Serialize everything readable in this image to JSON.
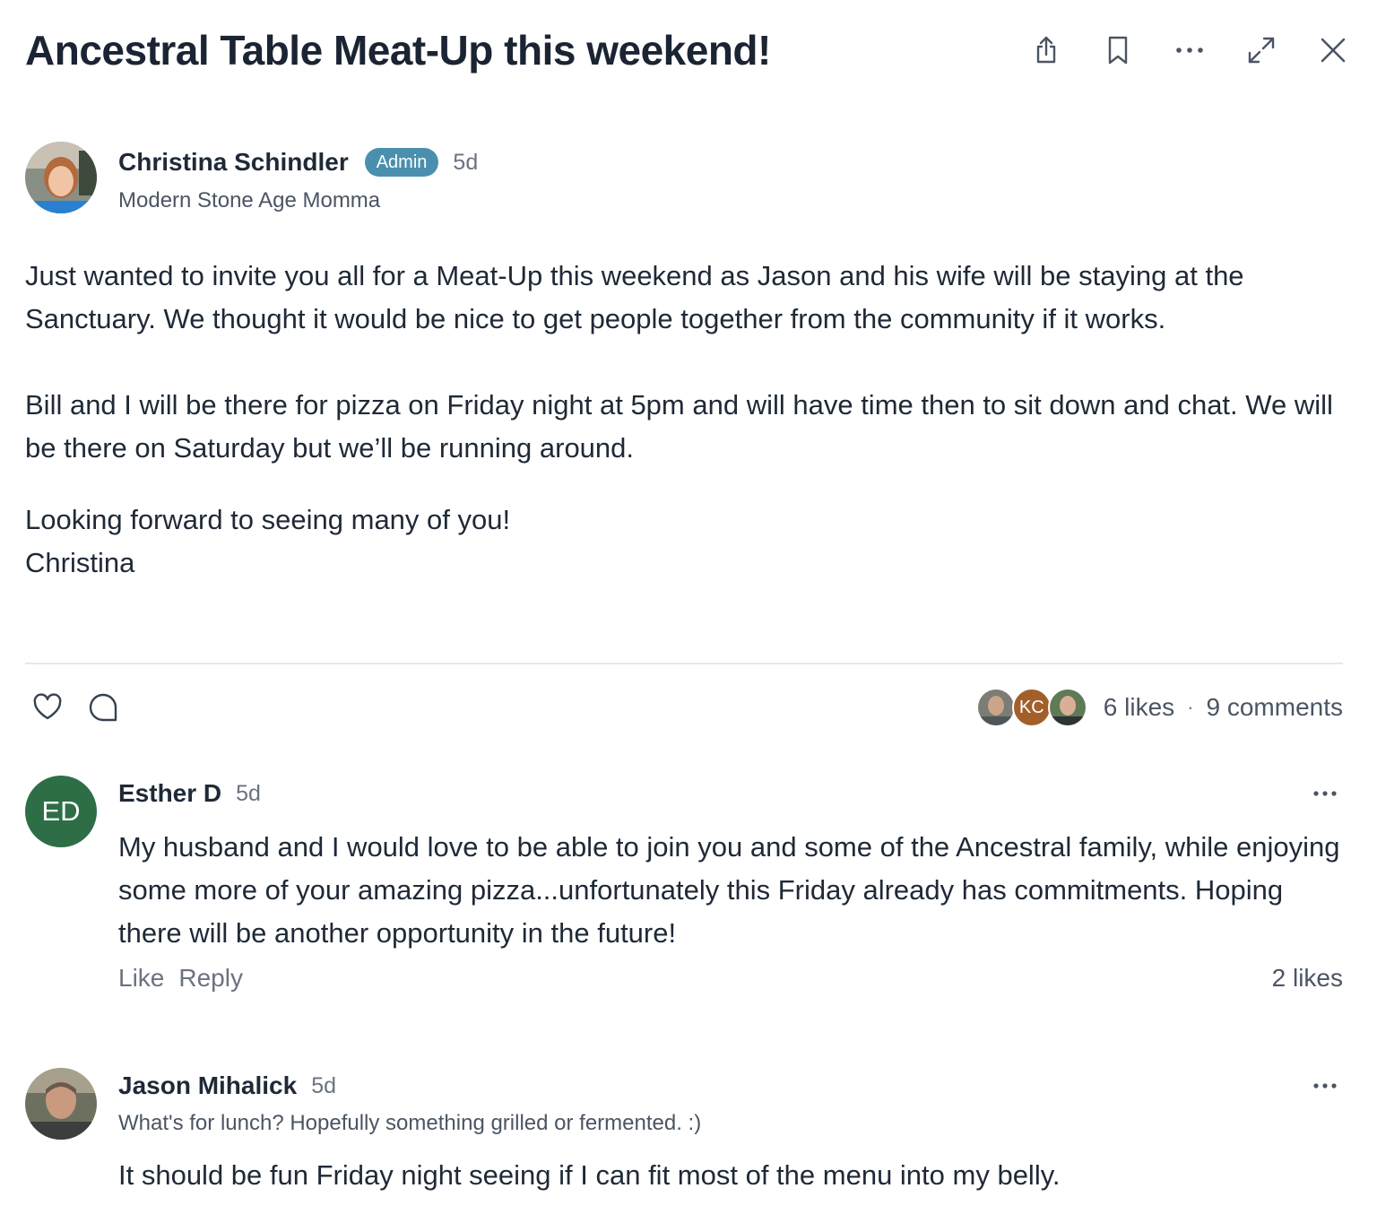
{
  "post": {
    "title": "Ancestral Table Meat-Up this weekend!",
    "author": {
      "name": "Christina Schindler",
      "badge": "Admin",
      "time": "5d",
      "subtitle": "Modern Stone Age Momma"
    },
    "paragraphs": [
      "Just wanted to invite you all for a Meat-Up this weekend as Jason and his wife will be staying at the Sanctuary. We thought it would be nice to get people together from the community if it works.",
      "Bill and I will be there for pizza on Friday night at 5pm and will have time then to sit down and chat. We will be there on Saturday but we’ll be running around.",
      "Looking forward to seeing many of you!",
      "Christina"
    ]
  },
  "header_icons": [
    "share-icon",
    "bookmark-icon",
    "more-icon",
    "expand-icon",
    "close-icon"
  ],
  "reactions": {
    "liker_initials": "KC",
    "likes": "6 likes",
    "separator": "·",
    "comments": "9 comments"
  },
  "comments": [
    {
      "initials": "ED",
      "name": "Esther D",
      "time": "5d",
      "text": "My husband and I would love to be able to join you and some of the Ancestral family, while enjoying some more of your amazing pizza...unfortunately this Friday already has commitments. Hoping there will be another opportunity in the future!",
      "like_label": "Like",
      "reply_label": "Reply",
      "likes": "2 likes"
    },
    {
      "name": "Jason Mihalick",
      "time": "5d",
      "subtitle": "What's for lunch? Hopefully something grilled or fermented. :)",
      "text": "It should be fun Friday night seeing if I can fit most of the menu into my belly."
    }
  ],
  "colors": {
    "admin_badge": "#4a90ae",
    "esther_avatar": "#2e6e47",
    "kc_avatar": "#a25f2a",
    "title": "#1b2433"
  }
}
